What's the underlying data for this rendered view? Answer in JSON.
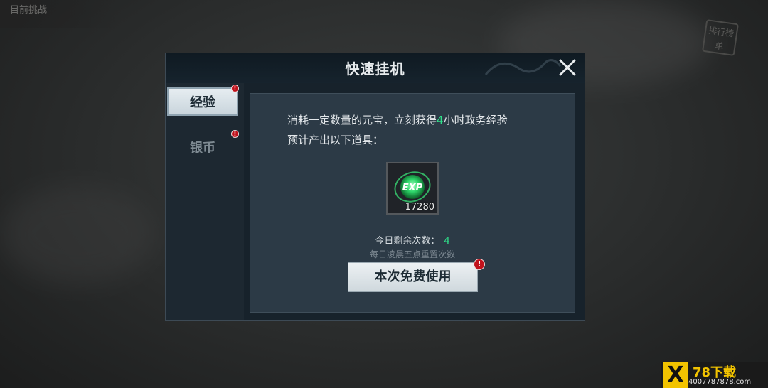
{
  "background": {
    "top_left_label": "目前挑战",
    "right_badge": "排行榜单"
  },
  "dialog": {
    "title": "快速挂机",
    "close_icon": "close-icon",
    "tabs": [
      {
        "label": "经验",
        "selected": true,
        "has_alert": true
      },
      {
        "label": "银币",
        "selected": false,
        "has_alert": true
      }
    ],
    "content": {
      "description_prefix": "消耗一定数量的元宝，立刻获得",
      "description_hours": "4",
      "description_suffix": "小时政务经验",
      "expected_output": "预计产出以下道具：",
      "item": {
        "icon": "exp-orb-icon",
        "label": "EXP",
        "count": "17280"
      },
      "remaining_label": "今日剩余次数：",
      "remaining_count": "4",
      "reset_note": "每日凌晨五点重置次数",
      "use_button": "本次免费使用"
    }
  },
  "watermark": {
    "logo": "X",
    "brand": "78下载",
    "url": "4007787878.com"
  },
  "colors": {
    "highlight_green": "#2fe08a",
    "alert_red": "#c0121c",
    "panel": "#2c3a46"
  }
}
